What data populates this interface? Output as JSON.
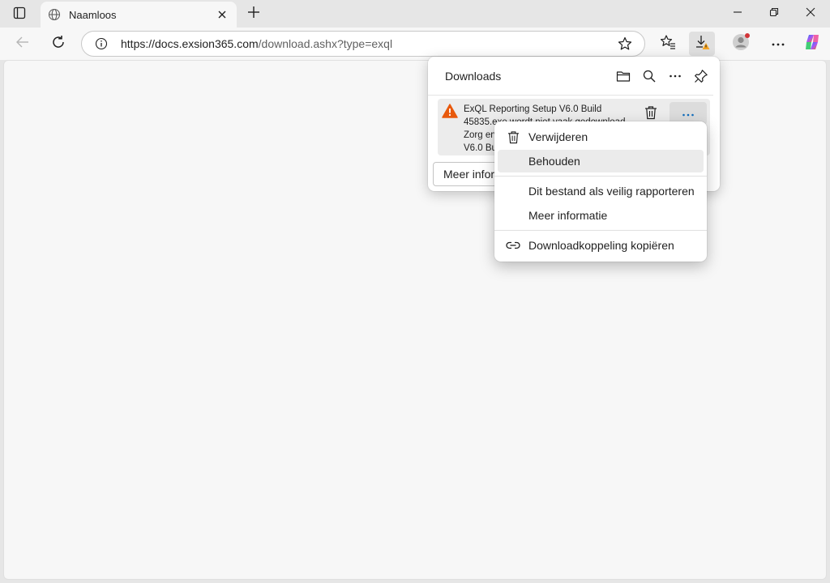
{
  "tab": {
    "title": "Naamloos"
  },
  "address": {
    "host": "https://docs.exsion365.com",
    "path": "/download.ashx?type=exql"
  },
  "downloads": {
    "title": "Downloads",
    "item_text": "ExQL Reporting Setup V6.0 Build 45835.exe wordt niet vaak gedownload. Zorg ervoor dat u ExQL Reporting Setup V6.0 Build 45835.exe vertrouwt voordat u het opent.",
    "more_info_button": "Meer informatie"
  },
  "context_menu": {
    "items": [
      {
        "label": "Verwijderen",
        "icon": "trash-icon"
      },
      {
        "label": "Behouden",
        "icon": ""
      },
      {
        "label": "Dit bestand als veilig rapporteren",
        "icon": ""
      },
      {
        "label": "Meer informatie",
        "icon": ""
      },
      {
        "label": "Downloadkoppeling kopiëren",
        "icon": "link-icon"
      }
    ]
  },
  "colors": {
    "warning": "#e8590c",
    "accent": "#0f6cbd"
  }
}
